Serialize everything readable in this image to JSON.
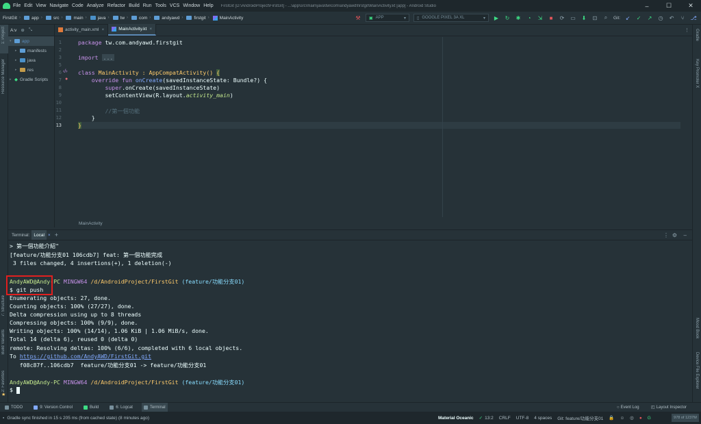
{
  "menubar": {
    "items": [
      "File",
      "Edit",
      "View",
      "Navigate",
      "Code",
      "Analyze",
      "Refactor",
      "Build",
      "Run",
      "Tools",
      "VCS",
      "Window",
      "Help"
    ],
    "window_title": "FirstGit [D:\\AndroidProject\\FirstGit] - ...\\app\\src\\main\\java\\tw\\com\\andyawd\\firstgit\\MainActivity.kt [app] - Android Studio",
    "minimize": "–",
    "maximize": "☐",
    "close": "✕"
  },
  "navbar": {
    "breadcrumbs": [
      "FirstGit",
      "app",
      "src",
      "main",
      "java",
      "tw",
      "com",
      "andyawd",
      "firstgit",
      "MainActivity"
    ],
    "run_config": "APP",
    "device": "GOOGLE PIXEL 3A XL",
    "git_label": "Git:"
  },
  "project_panel": {
    "view_label": "A:v",
    "items": [
      {
        "label": "app",
        "level": 0,
        "expanded": true
      },
      {
        "label": "manifests",
        "level": 1,
        "expanded": false
      },
      {
        "label": "java",
        "level": 1,
        "expanded": false
      },
      {
        "label": "res",
        "level": 1,
        "expanded": false
      },
      {
        "label": "Gradle Scripts",
        "level": 0,
        "expanded": false
      }
    ]
  },
  "left_strip": {
    "project": "1: Project",
    "resource_manager": "Resource Manager",
    "structure": "7: Structure",
    "build_variants": "Build Variants",
    "favorites": "2: Favorites"
  },
  "right_strip": {
    "gradle": "Gradle",
    "key_promoter": "Key Promoter X",
    "mood_book": "Mood Book",
    "device_file_explorer": "Device File Explorer"
  },
  "editor": {
    "tabs": [
      {
        "label": "activity_main.xml",
        "active": false,
        "close": "×"
      },
      {
        "label": "MainActivity.kt",
        "active": true,
        "close": "×"
      }
    ],
    "line_numbers": [
      "1",
      "2",
      "3",
      "5",
      "6",
      "7",
      "8",
      "9",
      "10",
      "11",
      "12",
      "13"
    ],
    "code": {
      "l1_kw": "package",
      "l1_rest": " tw.com.andyawd.firstgit",
      "l3_kw": "import",
      "l3_fold": "...",
      "l6_kw": "class",
      "l6_name": " MainActivity : AppCompatActivity() ",
      "l6_brace": "{",
      "l7_kw": "override fun ",
      "l7_fn": "onCreate",
      "l7_rest": "(savedInstanceState: Bundle?) {",
      "l8_kw": "super",
      "l8_rest": ".onCreate(savedInstanceState)",
      "l9_pre": "setContentView(R.layout.",
      "l9_it": "activity_main",
      "l9_post": ")",
      "l11": "//第一個功能",
      "l12": "}",
      "l13": "}"
    },
    "breadcrumb": "MainActivity"
  },
  "terminal": {
    "tabs": {
      "terminal": "Terminal:",
      "local": "Local",
      "add": "+"
    },
    "lines": {
      "t1": "> 第一個功能介紹\"",
      "t2": "[feature/功能分支01 106cdb7] feat: 第一個功能完成",
      "t3": " 3 files changed, 4 insertions(+), 1 deletion(-)",
      "p1_user": "AndyAWD@Andy-PC",
      "p1_shell": "MINGW64",
      "p1_path": "/d/AndroidProject/FirstGit",
      "p1_branch": "(feature/功能分支01)",
      "cmd": "$ git push",
      "o1": "Enumerating objects: 27, done.",
      "o2": "Counting objects: 100% (27/27), done.",
      "o3": "Delta compression using up to 8 threads",
      "o4": "Compressing objects: 100% (9/9), done.",
      "o5": "Writing objects: 100% (14/14), 1.06 KiB | 1.06 MiB/s, done.",
      "o6": "Total 14 (delta 6), reused 0 (delta 0)",
      "o7": "remote: Resolving deltas: 100% (6/6), completed with 6 local objects.",
      "o8_pre": "To ",
      "o8_link": "https://github.com/AndyAWD/FirstGit.git",
      "o9": "   f08c87f..106cdb7  feature/功能分支01 -> feature/功能分支01",
      "p2_user": "AndyAWD@Andy-PC",
      "p2_shell": "MINGW64",
      "p2_path": "/d/AndroidProject/FirstGit",
      "p2_branch": "(feature/功能分支01)",
      "prompt": "$ "
    }
  },
  "bottom_tools": [
    {
      "label": "TODO",
      "active": false
    },
    {
      "label": "9: Version Control",
      "active": false
    },
    {
      "label": "Build",
      "active": false
    },
    {
      "label": "6: Logcat",
      "active": false
    },
    {
      "label": "Terminal",
      "active": true
    }
  ],
  "bottom_right_tools": {
    "event_log": "Event Log",
    "layout_inspector": "Layout Inspector"
  },
  "status": {
    "message": "Gradle sync finished in 15 s 205 ms (from cached state) (8 minutes ago)",
    "theme": "Material Oceanic",
    "position": "13:2",
    "line_sep": "CRLF",
    "encoding": "UTF-8",
    "indent": "4 spaces",
    "git_branch": "Git: feature/功能分支01",
    "memory": "978 of 1237M"
  },
  "colors": {
    "accent": "#5c8bb8",
    "highlight_box": "#e2201f",
    "background": "#263238"
  }
}
